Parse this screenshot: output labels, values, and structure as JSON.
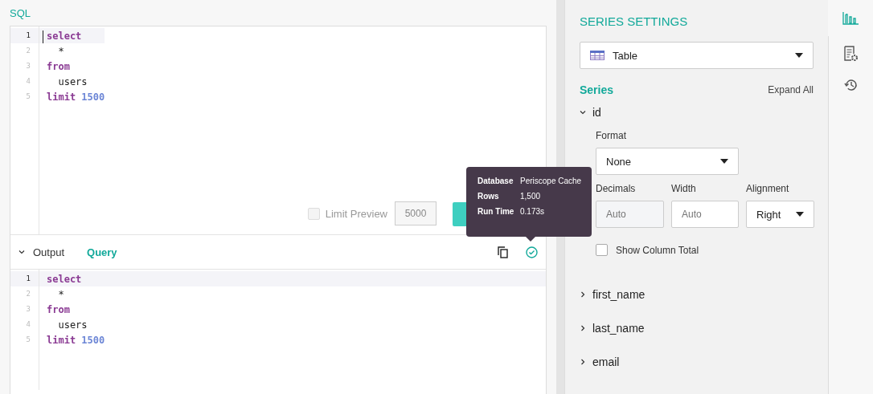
{
  "sql_editor": {
    "title": "SQL",
    "cursor": true,
    "lines": [
      {
        "number": "1",
        "active": true,
        "tokens": [
          {
            "kind": "keyword",
            "text": "select"
          }
        ]
      },
      {
        "number": "2",
        "active": false,
        "tokens": [
          {
            "kind": "plain",
            "text": "  *"
          }
        ]
      },
      {
        "number": "3",
        "active": false,
        "tokens": [
          {
            "kind": "keyword",
            "text": "from"
          }
        ]
      },
      {
        "number": "4",
        "active": false,
        "tokens": [
          {
            "kind": "plain",
            "text": "  users"
          }
        ]
      },
      {
        "number": "5",
        "active": false,
        "tokens": [
          {
            "kind": "keyword",
            "text": "limit"
          },
          {
            "kind": "number",
            "text": "1500"
          }
        ]
      }
    ],
    "limit_preview": {
      "label": "Limit Preview",
      "checked": false,
      "disabled": true,
      "value": "5000"
    }
  },
  "tooltip": {
    "rows": [
      {
        "label": "Database",
        "value": "Periscope Cache"
      },
      {
        "label": "Rows",
        "value": "1,500"
      },
      {
        "label": "Run Time",
        "value": "0.173s"
      }
    ]
  },
  "output": {
    "expanded": true,
    "tabs": [
      {
        "label": "Output",
        "selected": false
      },
      {
        "label": "Query",
        "selected": true
      }
    ],
    "lines": [
      {
        "number": "1",
        "active": true,
        "tokens": [
          {
            "kind": "keyword",
            "text": "select"
          }
        ]
      },
      {
        "number": "2",
        "active": false,
        "tokens": [
          {
            "kind": "plain",
            "text": "  *"
          }
        ]
      },
      {
        "number": "3",
        "active": false,
        "tokens": [
          {
            "kind": "keyword",
            "text": "from"
          }
        ]
      },
      {
        "number": "4",
        "active": false,
        "tokens": [
          {
            "kind": "plain",
            "text": "  users"
          }
        ]
      },
      {
        "number": "5",
        "active": false,
        "tokens": [
          {
            "kind": "keyword",
            "text": "limit"
          },
          {
            "kind": "number",
            "text": "1500"
          }
        ]
      }
    ]
  },
  "settings": {
    "title": "SERIES SETTINGS",
    "chart_type": "Table",
    "series_heading": "Series",
    "expand_all": "Expand All",
    "series": [
      {
        "name": "id",
        "expanded": true,
        "format": {
          "label": "Format",
          "value": "None"
        },
        "decimals": {
          "label": "Decimals",
          "placeholder": "Auto",
          "disabled": true
        },
        "width": {
          "label": "Width",
          "placeholder": "Auto",
          "disabled": false
        },
        "alignment": {
          "label": "Alignment",
          "value": "Right"
        },
        "column_total": {
          "label": "Show Column Total",
          "checked": false
        }
      },
      {
        "name": "first_name",
        "expanded": false
      },
      {
        "name": "last_name",
        "expanded": false
      },
      {
        "name": "email",
        "expanded": false
      }
    ]
  },
  "rail": [
    {
      "kind": "chart",
      "selected": true
    },
    {
      "kind": "settings",
      "selected": false
    },
    {
      "kind": "history",
      "selected": false
    }
  ]
}
